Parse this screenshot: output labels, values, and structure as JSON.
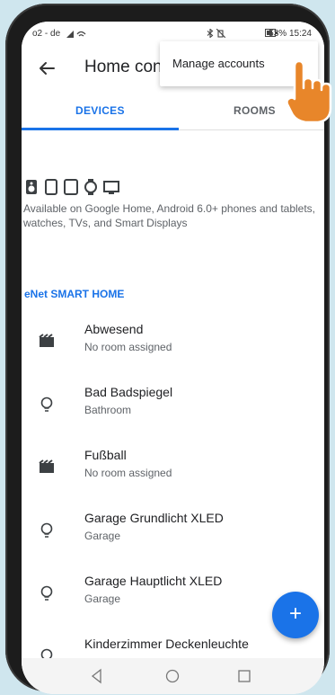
{
  "status_bar": {
    "carrier": "o2 - de",
    "right": "53%   15:24"
  },
  "app_bar": {
    "title": "Home con"
  },
  "overflow_menu": {
    "items": [
      "Manage accounts"
    ]
  },
  "tabs": [
    {
      "label": "DEVICES",
      "selected": true
    },
    {
      "label": "ROOMS",
      "selected": false
    }
  ],
  "availability": {
    "icons": [
      "speaker-icon",
      "tablet-icon",
      "phone-icon",
      "watch-icon",
      "tv-icon"
    ],
    "text": "Available on Google Home, Android 6.0+ phones and tablets, watches, TVs, and Smart Displays"
  },
  "section": {
    "title": "eNet SMART HOME"
  },
  "devices": [
    {
      "name": "Abwesend",
      "room": "No room assigned",
      "icon": "scene-icon"
    },
    {
      "name": "Bad Badspiegel",
      "room": "Bathroom",
      "icon": "lightbulb-icon"
    },
    {
      "name": "Fußball",
      "room": "No room assigned",
      "icon": "scene-icon"
    },
    {
      "name": "Garage Grundlicht XLED",
      "room": "Garage",
      "icon": "lightbulb-icon"
    },
    {
      "name": "Garage Hauptlicht XLED",
      "room": "Garage",
      "icon": "lightbulb-icon"
    },
    {
      "name": "Kinderzimmer Deckenleuchte",
      "room": "",
      "icon": "lightbulb-icon"
    }
  ],
  "fab": {
    "label": "+"
  },
  "colors": {
    "accent": "#1a73e8",
    "pointer_hand": "#e8862a",
    "background": "#cfe6ee"
  }
}
